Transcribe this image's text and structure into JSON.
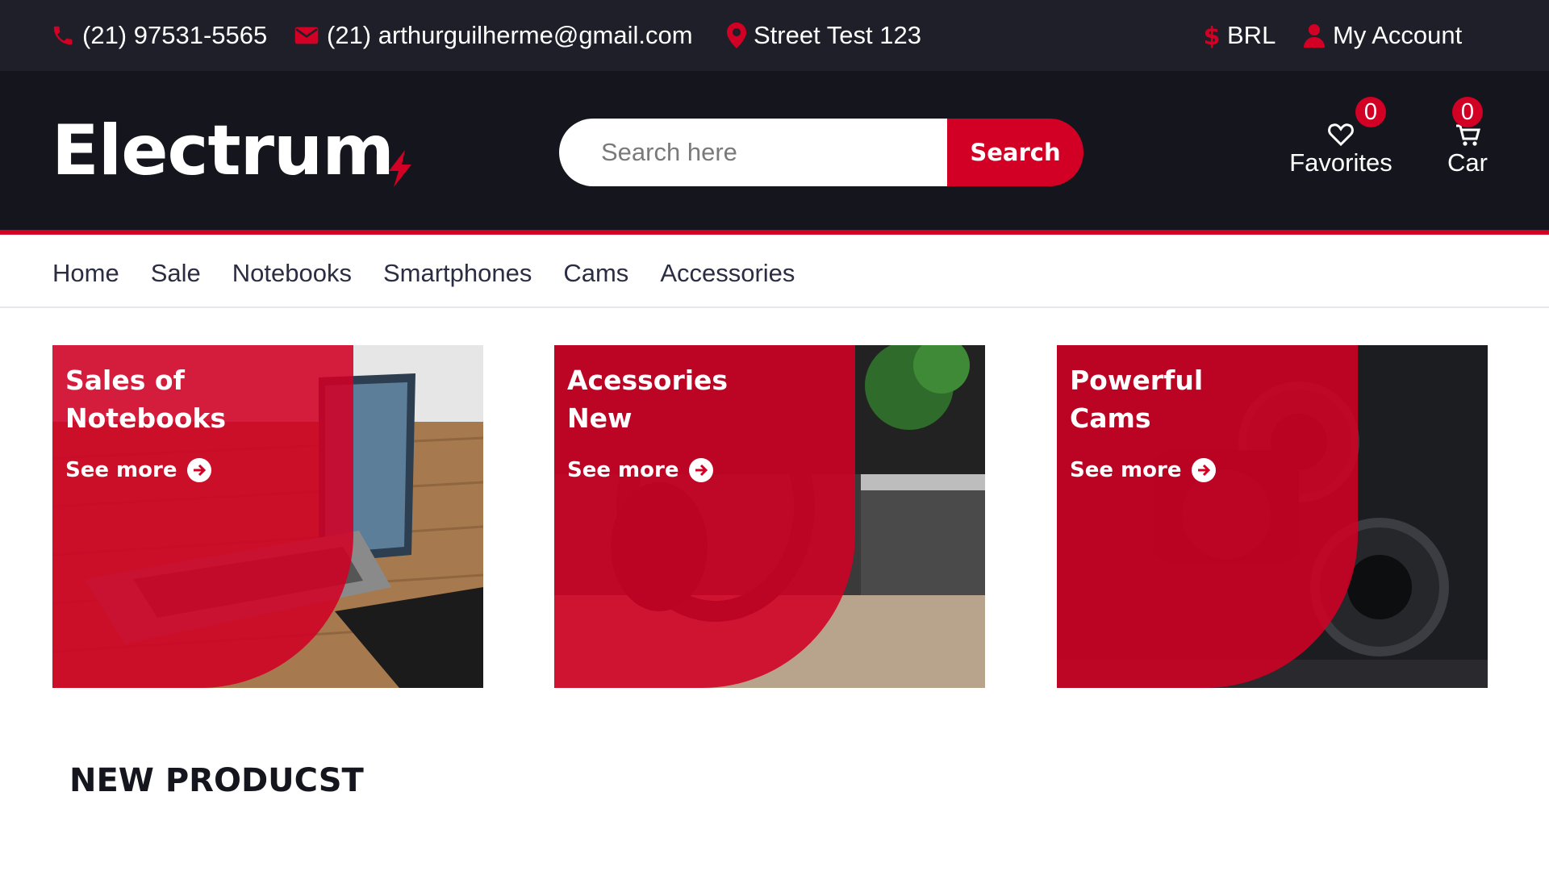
{
  "topbar": {
    "phone": "(21) 97531-5565",
    "email": "(21) arthurguilherme@gmail.com",
    "address": "Street Test 123",
    "currency": "BRL",
    "account": "My Account"
  },
  "header": {
    "logo": "Electrum",
    "search": {
      "placeholder": "Search here",
      "button": "Search"
    },
    "favorites": {
      "label": "Favorites",
      "count": "0"
    },
    "cart": {
      "label": "Car",
      "count": "0"
    }
  },
  "nav": [
    "Home",
    "Sale",
    "Notebooks",
    "Smartphones",
    "Cams",
    "Accessories"
  ],
  "banners": [
    {
      "title": [
        "Sales of",
        "Notebooks"
      ],
      "link": "See more"
    },
    {
      "title": [
        "Acessories",
        "New"
      ],
      "link": "See more"
    },
    {
      "title": [
        "Powerful",
        "Cams"
      ],
      "link": "See more"
    }
  ],
  "section_title": "NEW PRODUCST",
  "colors": {
    "accent": "#d10024",
    "topbar": "#1e1f29",
    "header": "#15161d"
  },
  "icons": [
    "phone-icon",
    "envelope-icon",
    "map-marker-icon",
    "dollar-icon",
    "user-icon",
    "heart-icon",
    "shopping-cart-icon",
    "lightning-bolt-icon",
    "arrow-circle-right-icon"
  ]
}
